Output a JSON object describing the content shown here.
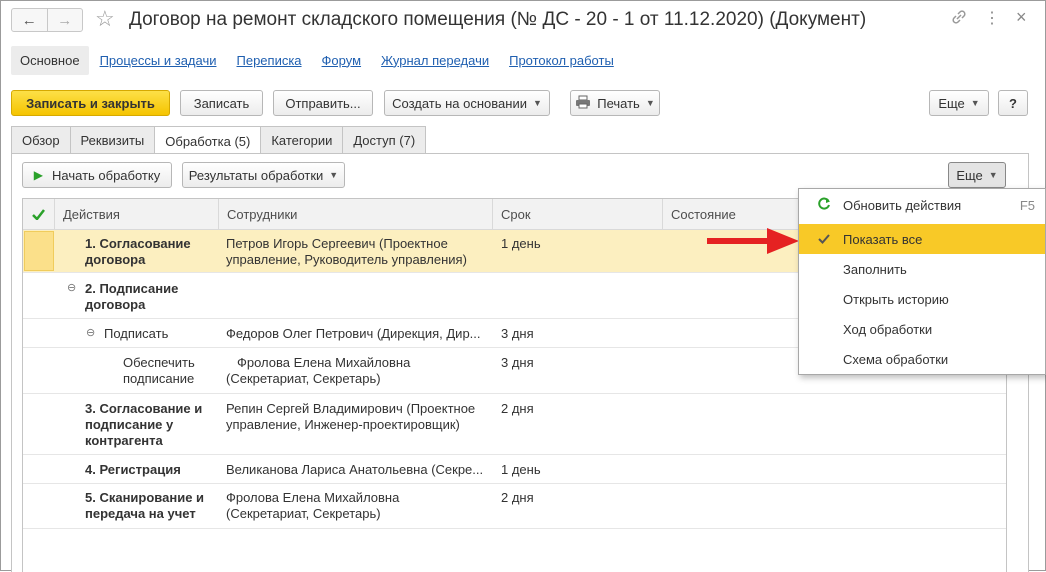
{
  "window": {
    "title": "Договор на ремонт складского помещения (№ ДС - 20 - 1 от 11.12.2020) (Документ)"
  },
  "nav_links": {
    "active": "Основное",
    "items": [
      "Процессы и задачи",
      "Переписка",
      "Форум",
      "Журнал передачи",
      "Протокол работы"
    ]
  },
  "toolbar": {
    "save_close": "Записать и закрыть",
    "save": "Записать",
    "send": "Отправить...",
    "create_based": "Создать на основании",
    "print": "Печать",
    "more": "Еще",
    "help": "?"
  },
  "tabs": [
    "Обзор",
    "Реквизиты",
    "Обработка (5)",
    "Категории",
    "Доступ (7)"
  ],
  "processing": {
    "start": "Начать обработку",
    "results": "Результаты обработки",
    "more": "Еще"
  },
  "grid": {
    "columns": [
      "Действия",
      "Сотрудники",
      "Срок",
      "Состояние"
    ],
    "rows": [
      {
        "action": [
          "1. Согласование",
          "договора"
        ],
        "employees": [
          "Петров Игорь Сергеевич (Проектное",
          "управление, Руководитель управления)"
        ],
        "term": "1 день"
      },
      {
        "action": [
          "2. Подписание",
          "договора"
        ],
        "employees": [],
        "term": ""
      },
      {
        "action": [
          "Подписать"
        ],
        "employees": [
          "Федоров Олег Петрович (Дирекция, Дир..."
        ],
        "term": "3 дня"
      },
      {
        "action": [
          "Обеспечить",
          "подписание"
        ],
        "employees": [
          "Фролова Елена Михайловна",
          "(Секретариат, Секретарь)"
        ],
        "term": "3 дня"
      },
      {
        "action": [
          "3. Согласование и",
          "подписание у",
          "контрагента"
        ],
        "employees": [
          "Репин Сергей Владимирович (Проектное",
          "управление, Инженер-проектировщик)"
        ],
        "term": "2 дня"
      },
      {
        "action": [
          "4. Регистрация"
        ],
        "employees": [
          "Великанова Лариса Анатольевна (Секре..."
        ],
        "term": "1 день"
      },
      {
        "action": [
          "5. Сканирование и",
          "передача на учет"
        ],
        "employees": [
          "Фролова Елена Михайловна",
          "(Секретариат, Секретарь)"
        ],
        "term": "2 дня"
      }
    ]
  },
  "menu": {
    "items": [
      {
        "label": "Обновить действия",
        "shortcut": "F5",
        "icon": "refresh-icon"
      },
      {
        "label": "Показать все",
        "icon": "checkmark-icon",
        "checked": true
      },
      {
        "label": "Заполнить"
      },
      {
        "label": "Открыть историю"
      },
      {
        "label": "Ход обработки"
      },
      {
        "label": "Схема обработки"
      }
    ]
  },
  "colors": {
    "primary_button": "#f5c400",
    "highlight": "#f8c927",
    "selected_row": "#fcefc0",
    "link": "#1f5fb0",
    "arrow": "#e52222"
  }
}
